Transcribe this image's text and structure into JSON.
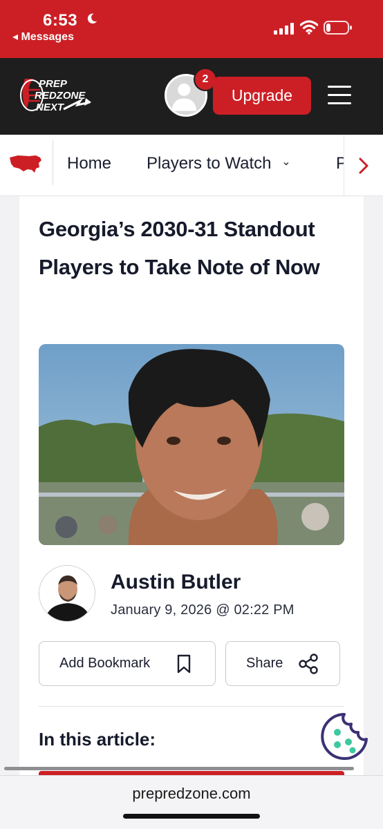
{
  "status_bar": {
    "time": "6:53",
    "back_label": "◂ Messages"
  },
  "header": {
    "logo_text": [
      "PREP",
      "REDZONE",
      "NEXT"
    ],
    "notification_count": "2",
    "upgrade_label": "Upgrade"
  },
  "nav": {
    "items": [
      {
        "label": "Home"
      },
      {
        "label": "Players to Watch"
      },
      {
        "label": "P"
      }
    ],
    "dropdown_glyph": "⌄"
  },
  "article": {
    "title": "Georgia’s 2030-31 Standout Players to Take Note of Now",
    "author_name": "Austin Butler",
    "date": "January 9, 2026 @ 02:22 PM",
    "bookmark_label": "Add Bookmark",
    "share_label": "Share",
    "toc_heading": "In this article:"
  },
  "browser": {
    "url": "prepredzone.com"
  },
  "colors": {
    "brand_red": "#cc1f25",
    "header_dark": "#1e1e1e",
    "cookie_teal": "#3ec8a0",
    "cookie_outline": "#3a3175"
  }
}
